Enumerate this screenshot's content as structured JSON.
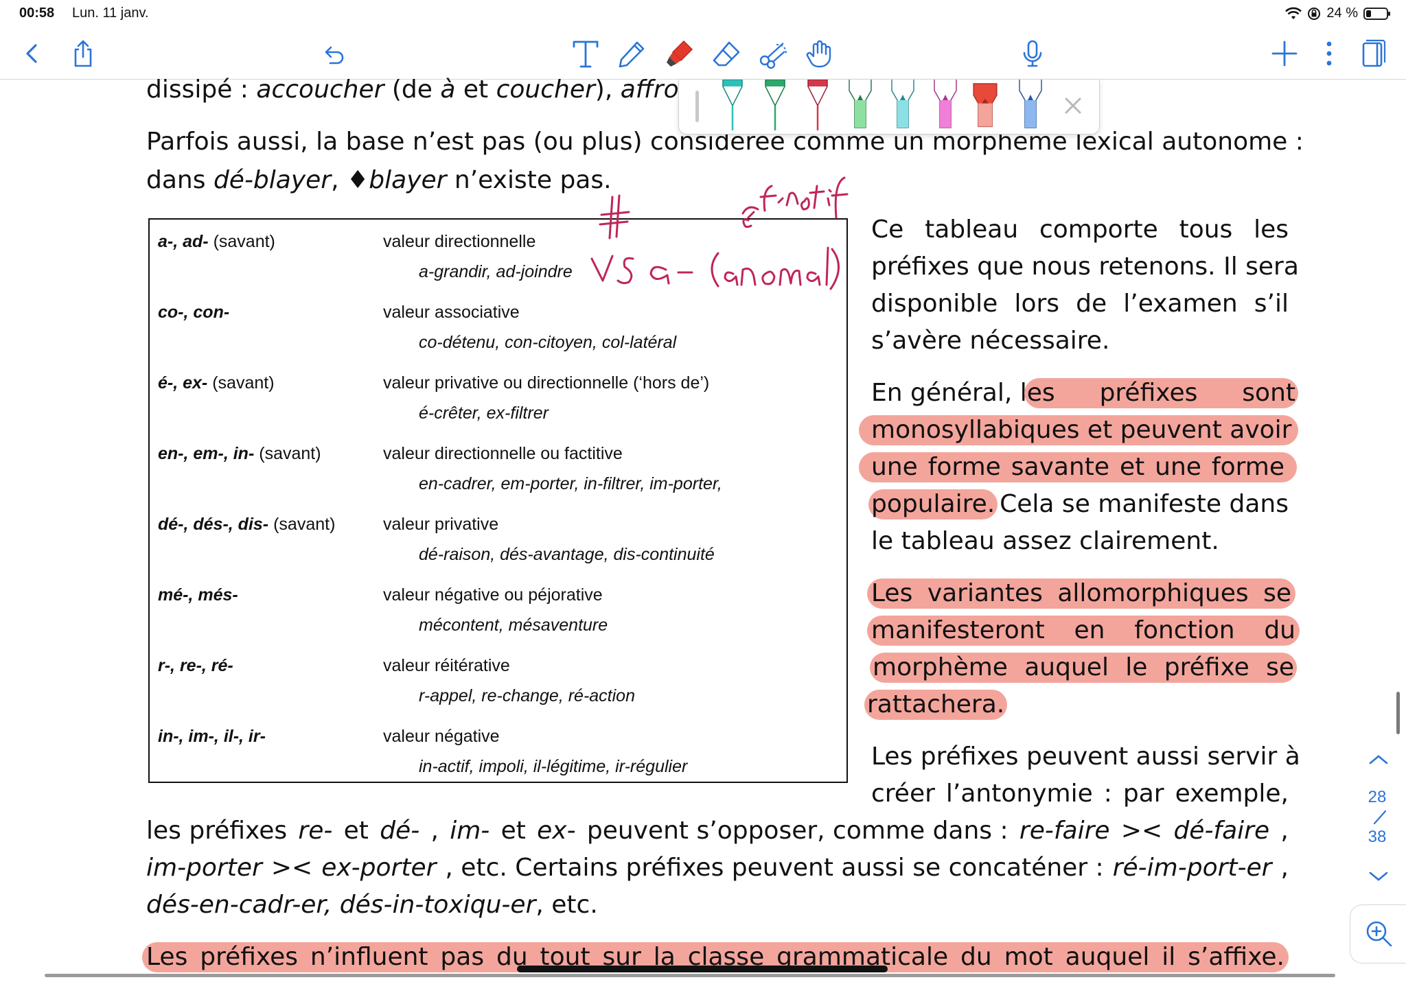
{
  "status": {
    "time": "00:58",
    "date": "Lun. 11 janv.",
    "battery_label": "24 %",
    "icons": [
      "wifi-icon",
      "location-lock-icon",
      "battery-icon"
    ]
  },
  "toolbar": {
    "tools": [
      "back-icon",
      "share-icon",
      "undo-icon",
      "text-tool-icon",
      "pen-icon",
      "highlighter-icon",
      "eraser-icon",
      "lasso-scissors-icon",
      "hand-icon",
      "microphone-icon",
      "add-icon",
      "more-icon",
      "pages-icon"
    ],
    "accent": "#2b74d8"
  },
  "palette": {
    "pens": [
      {
        "name": "pen-teal",
        "color": "#2ec0b6"
      },
      {
        "name": "pen-green",
        "color": "#2ea86a"
      },
      {
        "name": "pen-red",
        "color": "#d23a4a"
      },
      {
        "name": "highlighter-green",
        "color": "#8ee0a0"
      },
      {
        "name": "highlighter-cyan",
        "color": "#8be0e6"
      },
      {
        "name": "highlighter-pink",
        "color": "#f07fd8"
      },
      {
        "name": "highlighter-salmon-selected",
        "color": "#e8493a"
      },
      {
        "name": "highlighter-blue",
        "color": "#5e9ff0"
      }
    ]
  },
  "doc": {
    "top_cut_line": {
      "t1": "dissipé : ",
      "t2": "accoucher",
      "t3": " (de ",
      "t4": "à",
      "t5": " et ",
      "t6": "coucher",
      "t7": "), ",
      "t8": "affron"
    },
    "para1_line1": "Parfois aussi, la base n’est pas (ou plus) considérée comme un morphème lexical autonome :",
    "para1_line2": {
      "t1": "dans ",
      "t2": "dé-blayer",
      "t3": ", ",
      "t4": "♦",
      "t5": "blayer",
      "t6": " n’existe pas."
    },
    "table": {
      "rows": [
        {
          "prefix": "a-, ad-",
          "savant": "(savant)",
          "value": "valeur directionnelle",
          "examples": "a-grandir, ad-joindre"
        },
        {
          "prefix": "co-, con-",
          "savant": "",
          "value": "valeur associative",
          "examples": "co-détenu, con-citoyen, col-latéral"
        },
        {
          "prefix": "é-, ex-",
          "savant": "(savant)",
          "value": "valeur privative ou directionnelle (‘hors de’)",
          "examples": "é-crêter, ex-filtrer"
        },
        {
          "prefix": "en-, em-, in-",
          "savant": "(savant)",
          "value": "valeur directionnelle ou factitive",
          "examples": "en-cadrer,  em-porter, in-filtrer, im-porter,"
        },
        {
          "prefix": "dé-, dés-, dis-",
          "savant": "(savant)",
          "value": "valeur privative",
          "examples": "dé-raison, dés-avantage, dis-continuité"
        },
        {
          "prefix": "mé-, més-",
          "savant": "",
          "value": "valeur négative ou péjorative",
          "examples": "mécontent, mésaventure"
        },
        {
          "prefix": "r-, re-, ré-",
          "savant": "",
          "value": "valeur réitérative",
          "examples": "r-appel, re-change, ré-action"
        },
        {
          "prefix": "in-, im-, il-, ir-",
          "savant": "",
          "value": "valeur négative",
          "examples": "in-actif, impoli, il-légitime, ir-régulier"
        }
      ]
    },
    "side_para1": [
      "Ce tableau comporte tous les",
      "préfixes que nous retenons. Il sera",
      "disponible lors de l’examen s’il",
      "s’avère nécessaire."
    ],
    "side_para2": {
      "l1a": "En général, l",
      "l1b": "es préfixes sont",
      "l2": "monosyllabiques et peuvent avoir",
      "l3": "une forme savante et une forme",
      "l4a": "populaire.",
      "l4b": " Cela se manifeste dans",
      "l5": "le tableau assez clairement."
    },
    "side_para3": [
      "Les variantes allomorphiques se",
      "manifesteront en fonction du",
      "morphème auquel le préfixe se",
      "rattachera."
    ],
    "side_para4": [
      "Les préfixes peuvent aussi servir à",
      "créer l’antonymie : par exemple,"
    ],
    "full1": {
      "t1": "les préfixes ",
      "t2": "re-",
      "t3": " et ",
      "t4": "dé-",
      "t5": ", ",
      "t6": "im-",
      "t7": " et ",
      "t8": "ex-",
      "t9": " peuvent s’opposer, comme dans : ",
      "t10": "re-faire",
      "t11": " >< ",
      "t12": "dé-faire",
      "t13": ","
    },
    "full2": {
      "t1": "im-porter",
      "t2": " >< ",
      "t3": "ex-porter",
      "t4": ", etc. Certains préfixes peuvent aussi se concaténer : ",
      "t5": "ré-im-port-er",
      "t6": ","
    },
    "full3": {
      "t1": "dés-en-cadr-er, dés-in-toxiqu-er",
      "t2": ", etc."
    },
    "last_line": "Les préfixes n’influent pas du tout sur la classe grammaticale du mot auquel il s’affixe.",
    "highlight_color": "#f3a59c"
  },
  "page_nav": {
    "current": "28",
    "sep": "/",
    "total": "38"
  }
}
